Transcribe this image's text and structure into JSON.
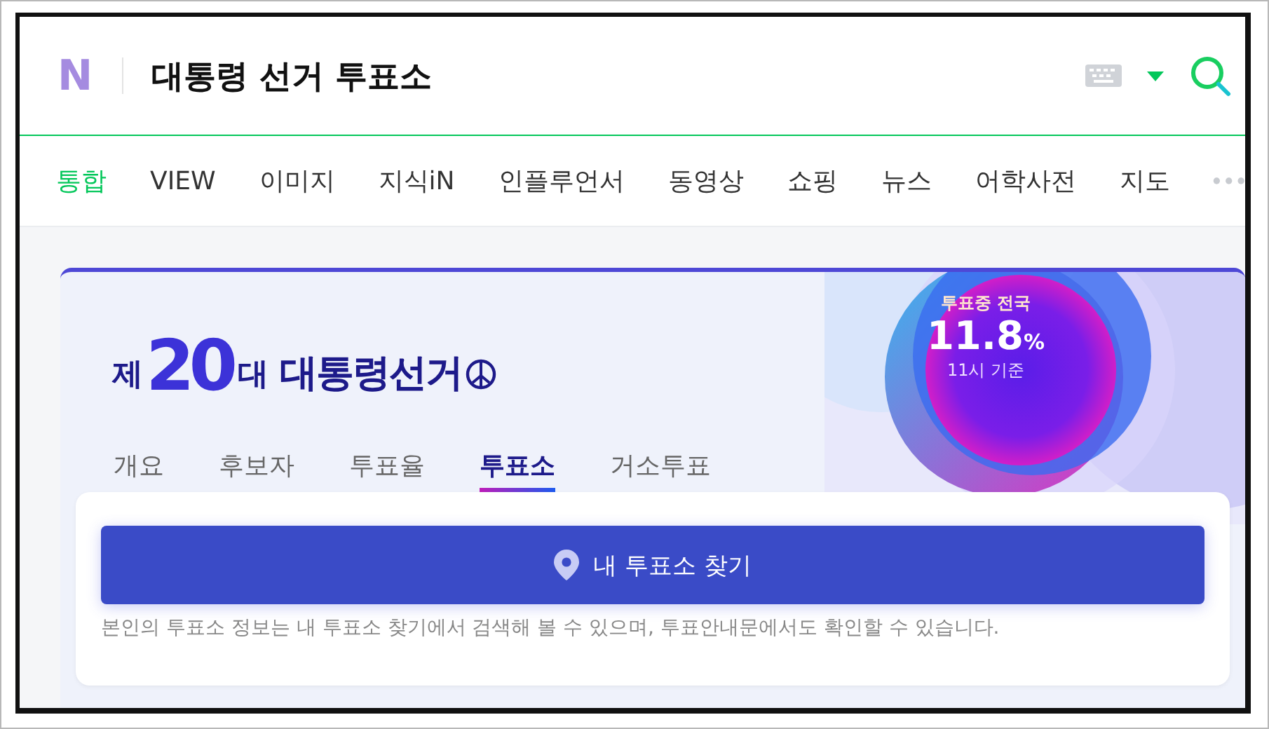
{
  "header": {
    "logo": "N",
    "query": "대통령 선거 투표소"
  },
  "nav": [
    {
      "label": "통합",
      "selected": true
    },
    {
      "label": "VIEW",
      "selected": false
    },
    {
      "label": "이미지",
      "selected": false
    },
    {
      "label": "지식iN",
      "selected": false
    },
    {
      "label": "인플루언서",
      "selected": false
    },
    {
      "label": "동영상",
      "selected": false
    },
    {
      "label": "쇼핑",
      "selected": false
    },
    {
      "label": "뉴스",
      "selected": false
    },
    {
      "label": "어학사전",
      "selected": false
    },
    {
      "label": "지도",
      "selected": false
    }
  ],
  "election": {
    "prefix": "제",
    "number": "20",
    "suffix": "대",
    "title": "대통령선거",
    "turnout": {
      "label": "투표중 전국",
      "value": "11.8",
      "unit": "%",
      "basis": "11시 기준"
    },
    "tabs": [
      {
        "label": "개요",
        "selected": false
      },
      {
        "label": "후보자",
        "selected": false
      },
      {
        "label": "투표율",
        "selected": false
      },
      {
        "label": "투표소",
        "selected": true
      },
      {
        "label": "거소투표",
        "selected": false
      }
    ],
    "find_button": "내 투표소 찾기",
    "note": "본인의 투표소 정보는 내 투표소 찾기에서 검색해 볼 수 있으며, 투표안내문에서도 확인할 수 있습니다."
  }
}
